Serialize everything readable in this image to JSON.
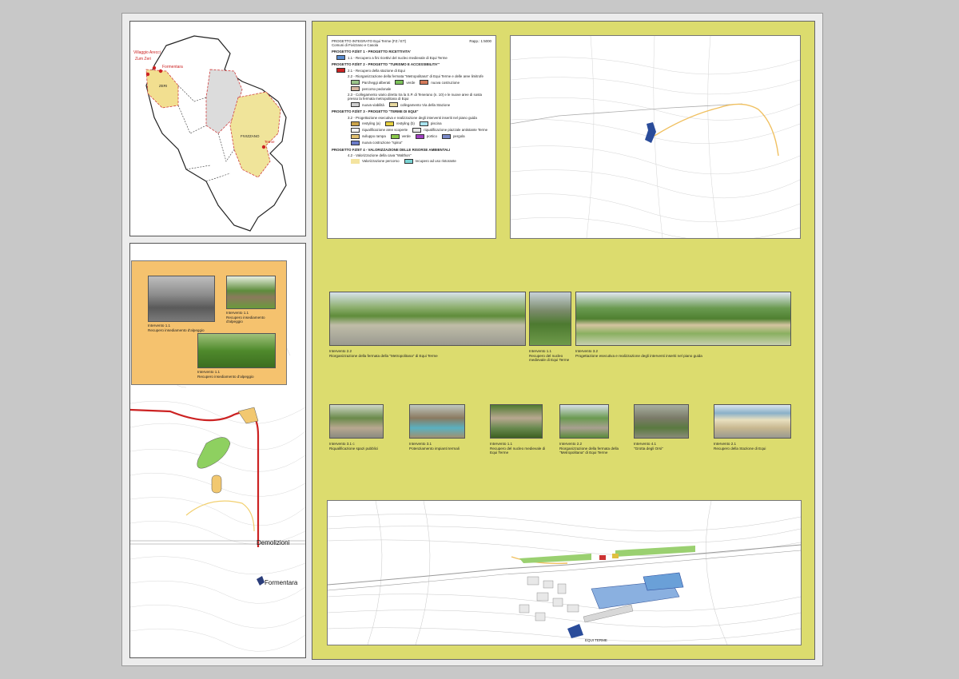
{
  "colors": {
    "page": "#c8c8c8",
    "board": "#dcdc6e",
    "orange_box": "#f5c26e",
    "road_red": "#cc2222"
  },
  "regional_map": {
    "places": [
      "Villaggio Arecci",
      "Zum Zeri",
      "Formentara",
      "ZERI",
      "FIVIZZANO",
      "Terme"
    ]
  },
  "trail_map": {
    "labels": [
      "Demolizioni",
      "Formentara"
    ]
  },
  "orange_box": {
    "captions": [
      {
        "title": "Intervento 1.1",
        "text": "Recupero insediamento d'alpeggio"
      },
      {
        "title": "Intervento 1.1",
        "text": "Recupero insediamento d'alpeggio"
      },
      {
        "title": "Intervento 1.1",
        "text": "Recupero insediamento d'alpeggio"
      }
    ]
  },
  "legend": {
    "title": "PROGETTO INTEGRATO Equi Terme  (FZ / ET)",
    "subtitle": "Comuni di Fivizzano e Casola",
    "scale": "Rapp.: 1:5000",
    "sections": [
      {
        "header": "PROGETTO FZ/ET 1 - PROGETTO RICETTIVITA'",
        "items": [
          "1.1 - Recupero a fini ricettivi del nucleo medievale di Equi Terme"
        ]
      },
      {
        "header": "PROGETTO FZ/ET 2 - PROGETTO \"TURISMO E ACCESSIBILITA'\"",
        "items": [
          "2.1 - Recupero della stazione di Equi",
          "2.2 - Riorganizzazione della fermata \"Metropolitana\" di Equi Terme e delle aree limitrofe",
          "2.3 - Collegamento viario diretto tra la S.P. di Tenerano (n. 10) e le nuove aree di sosta presso la fermata metropolitana di Equi"
        ]
      },
      {
        "header": "PROGETTO FZ/ET 3 - PROGETTO \"TERME DI EQUI\"",
        "items": [
          "3.2 - Progettazione esecutiva e realizzazione degli interventi inseriti nel piano guida"
        ]
      },
      {
        "header": "PROGETTO FZ/ET 4 - VALORIZZAZIONE DELLE RISORSE AMBIENTALI",
        "items": [
          "4.2 - Valorizzazione della cava \"Walthon\""
        ]
      }
    ],
    "swatches_22": [
      "Parcheggi alberati",
      "verde",
      "nuova costruzione",
      "percorso pedonale"
    ],
    "swatches_23": [
      "nuova viabilità",
      "collegamento Via della Stazione"
    ],
    "swatches_32": [
      "restyling (a)",
      "restyling (b)",
      "piscina",
      "riqualificazione aree scoperte",
      "riqualificazione piazzale antistante Terme",
      "sviluppo rampa",
      "verde",
      "portico",
      "pergola",
      "nuova costruzione \"spina\""
    ],
    "swatches_42": [
      "Valorizzazione percorso",
      "recupero ad uso ristorante"
    ]
  },
  "large_photos": [
    {
      "title": "Intervento 2.2",
      "text": "Riorganizzazione della fermata della \"Metropolitana\" di Equi Terme"
    },
    {
      "title": "Intervento 1.1",
      "text": "Recupero del nucleo medievale di Equi Terme"
    },
    {
      "title": "Intervento 3.2",
      "text": "Progettazione esecutiva e realizzazione degli interventi inseriti nel piano guida"
    }
  ],
  "small_photos": [
    {
      "title": "Intervento 3.1 c",
      "text": "Riqualificazione spazi pubblici"
    },
    {
      "title": "Intervento 3.1",
      "text": "Potenziamento impianti termali"
    },
    {
      "title": "Intervento 1.1",
      "text": "Recupero del nucleo medievale di Equi Terme"
    },
    {
      "title": "Intervento 2.2",
      "text": "Riorganizzazione della fermata della \"Metropolitana\" di Equi Terme"
    },
    {
      "title": "Intervento 4.1",
      "text": "\"Grotta degli Orsi\""
    },
    {
      "title": "Intervento 2.1",
      "text": "Recupero della Stazione di Equi"
    }
  ],
  "bottom_map": {
    "label": "EQUI TERME"
  }
}
